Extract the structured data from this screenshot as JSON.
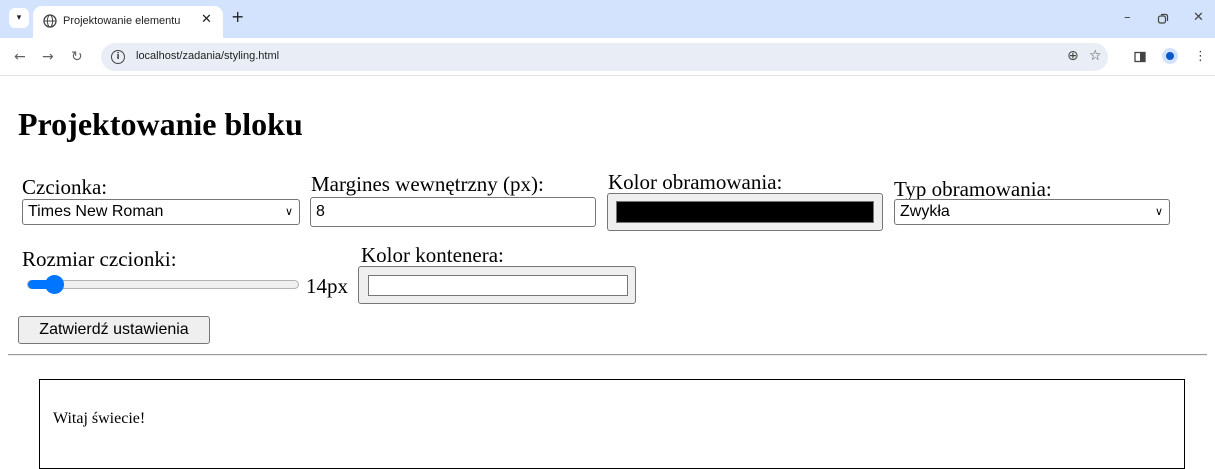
{
  "browser": {
    "tab_title": "Projektowanie elementu",
    "url": "localhost/zadania/styling.html"
  },
  "icons": {
    "tab_list": "chevron-down-icon",
    "favicon": "globe-icon",
    "tab_close": "close-icon",
    "new_tab": "plus-icon",
    "minimize": "minimize-icon",
    "restore": "restore-icon",
    "window_close": "close-icon",
    "back": "back-arrow-icon",
    "forward": "forward-arrow-icon",
    "reload": "reload-icon",
    "site_info": "info-icon",
    "zoom": "zoom-icon",
    "bookmark": "star-icon",
    "side_panel": "side-panel-icon",
    "profile": "profile-icon",
    "menu": "kebab-menu-icon"
  },
  "page": {
    "title": "Projektowanie bloku",
    "font_label": "Czcionka:",
    "font_value": "Times New Roman",
    "padding_label": "Margines wewnętrzny (px):",
    "padding_value": "8",
    "border_color_label": "Kolor obramowania:",
    "border_color_value": "#000000",
    "border_type_label": "Typ obramowania:",
    "border_type_value": "Zwykła",
    "font_size_label": "Rozmiar czcionki:",
    "font_size_display": "14px",
    "font_size_fraction": 0.07,
    "container_color_label": "Kolor kontenera:",
    "container_color_value": "#ffffff",
    "submit_label": "Zatwierdź ustawienia",
    "preview_text": "Witaj świecie!"
  },
  "colors": {
    "chrome_tabbar": "#d3e3fd",
    "omnibox": "#e9eef6",
    "slider_accent": "#0075ff"
  }
}
